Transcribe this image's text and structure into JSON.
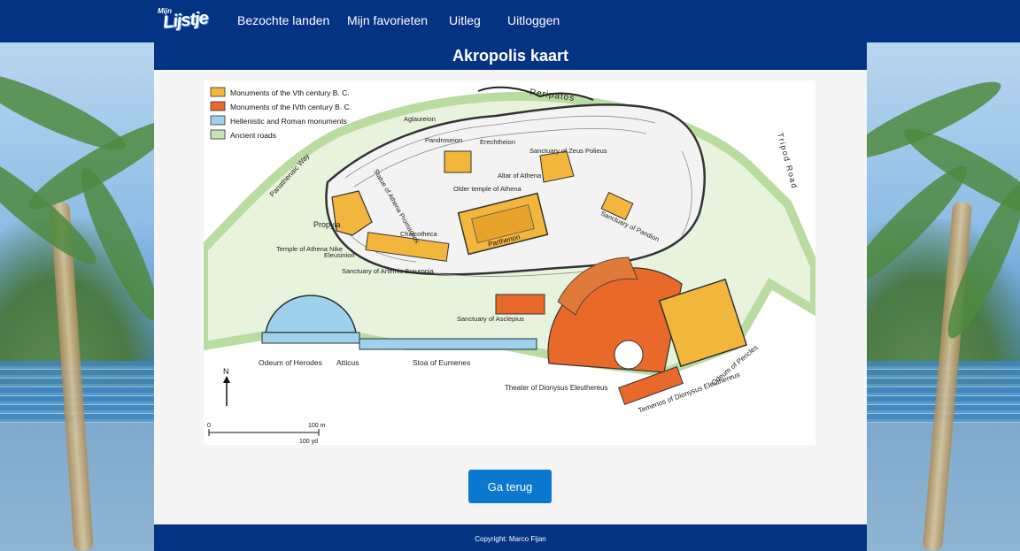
{
  "header": {
    "logo_small": "Mijn",
    "logo_big": "Lijstje",
    "nav": [
      {
        "label": "Bezochte landen"
      },
      {
        "label": "Mijn favorieten"
      },
      {
        "label": "Uitleg"
      },
      {
        "label": "Uitloggen"
      }
    ]
  },
  "page": {
    "title": "Akropolis kaart",
    "back_button": "Ga terug"
  },
  "map": {
    "legend": [
      {
        "label": "Monuments of the Vth century B. C.",
        "color": "#f2b63c"
      },
      {
        "label": "Monuments of the IVth century B. C.",
        "color": "#e8692a"
      },
      {
        "label": "Hellenistic and Roman monuments",
        "color": "#9fd1ec"
      },
      {
        "label": "Ancient roads",
        "color": "#c9e3b5"
      }
    ],
    "labels": {
      "peripatos": "Peripatos",
      "aglaureion": "Aglaureion",
      "pandroseion": "Pandroseion",
      "erechtheion": "Erechtheion",
      "sanctuary_zeus": "Sanctuary of Zeus Polieus",
      "panathenaic_way": "Panathenaic Way",
      "statue_athena": "Statue of Athena Promachos",
      "older_temple": "Older temple of Athena",
      "altar": "Altar of Athena",
      "tripod_road": "Tripod Road",
      "propyla": "Propyla",
      "chalcotheca": "Chalcotheca",
      "sanctuary_pandion": "Sanctuary of Pandion",
      "parthenon": "Parthenon",
      "temple_nike": "Temple of Athena Nike",
      "eleusinion": "Eleusinion",
      "sanctuary_artemis": "Sanctuary of Artemis Brauronia",
      "sanctuary_asclepius": "Sanctuary of Asclepius",
      "odeum_herodes": "Odeum of Herodes",
      "atticus": "Atticus",
      "stoa": "Stoa of Eumenes",
      "odeum_pericles": "Odeum of Pericles",
      "theater": "Theater of Dionysus Eleuthereus",
      "temenos": "Temenos of Dionysus Eleuthereus",
      "north": "N",
      "scale_zero": "0",
      "scale_m": "100 m",
      "scale_yd": "100 yd"
    }
  },
  "footer": {
    "copyright": "Copyright: Marco Fijan"
  }
}
